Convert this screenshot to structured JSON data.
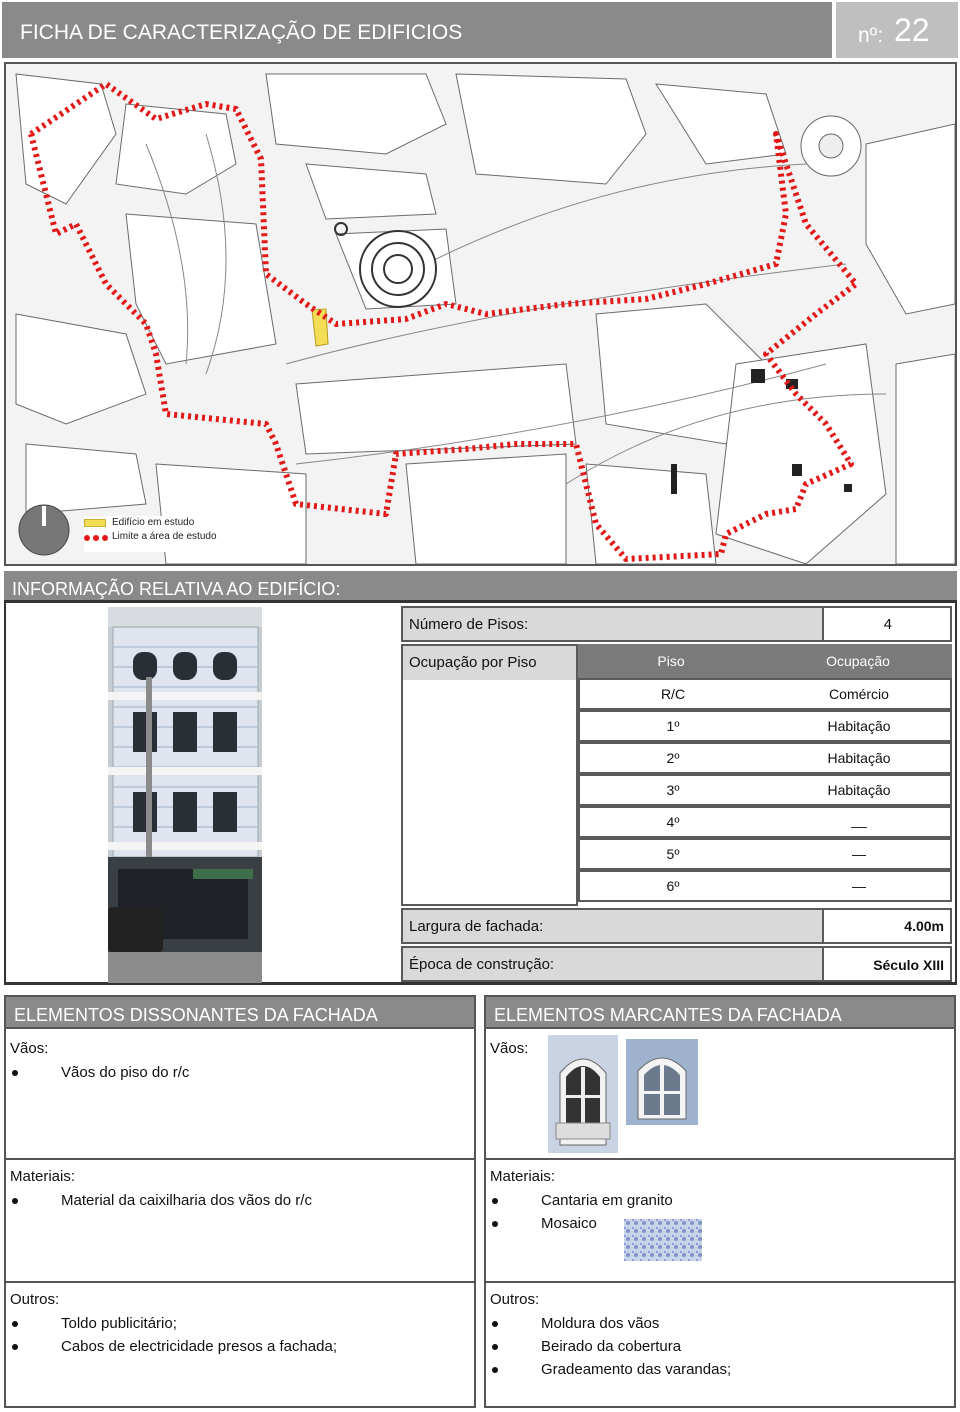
{
  "header": {
    "title": "FICHA DE CARACTERIZAÇÃO DE EDIFICIOS",
    "number_label": "nº:",
    "number": "22"
  },
  "map": {
    "legend": {
      "building": "Edifício em estudo",
      "limit": "Limite a área de estudo"
    },
    "colors": {
      "limit": "#e31919",
      "building": "#f3dd55"
    }
  },
  "info": {
    "section_title": "INFORMAÇÃO RELATIVA AO EDIFÍCIO:",
    "floors_label": "Número de Pisos:",
    "floors_value": "4",
    "occupation_label": "Ocupação por Piso",
    "col_piso": "Piso",
    "col_ocupacao": "Ocupação",
    "rows": [
      {
        "piso": "R/C",
        "ocupacao": "Comércio"
      },
      {
        "piso": "1º",
        "ocupacao": "Habitação"
      },
      {
        "piso": "2º",
        "ocupacao": "Habitação"
      },
      {
        "piso": "3º",
        "ocupacao": "Habitação"
      },
      {
        "piso": "4º",
        "ocupacao": "__"
      },
      {
        "piso": "5º",
        "ocupacao": "—"
      },
      {
        "piso": "6º",
        "ocupacao": "—"
      }
    ],
    "width_label": "Largura de fachada:",
    "width_value": "4.00m",
    "epoch_label": "Época de construção:",
    "epoch_value": "Século XIII"
  },
  "dissonant": {
    "title": "ELEMENTOS DISSONANTES DA FACHADA",
    "vaos_label": "Vãos:",
    "vaos": [
      "Vãos do piso do r/c"
    ],
    "materiais_label": "Materiais:",
    "materiais": [
      "Material da caixilharia dos vãos do r/c"
    ],
    "outros_label": "Outros:",
    "outros": [
      "Toldo publicitário;",
      "Cabos de electricidade presos a fachada;"
    ]
  },
  "marcantes": {
    "title": "ELEMENTOS MARCANTES DA FACHADA",
    "vaos_label": "Vãos:",
    "materiais_label": "Materiais:",
    "materiais": [
      "Cantaria em granito",
      "Mosaico"
    ],
    "outros_label": "Outros:",
    "outros": [
      "Moldura dos vãos",
      "Beirado da cobertura",
      "Gradeamento das varandas;"
    ]
  }
}
